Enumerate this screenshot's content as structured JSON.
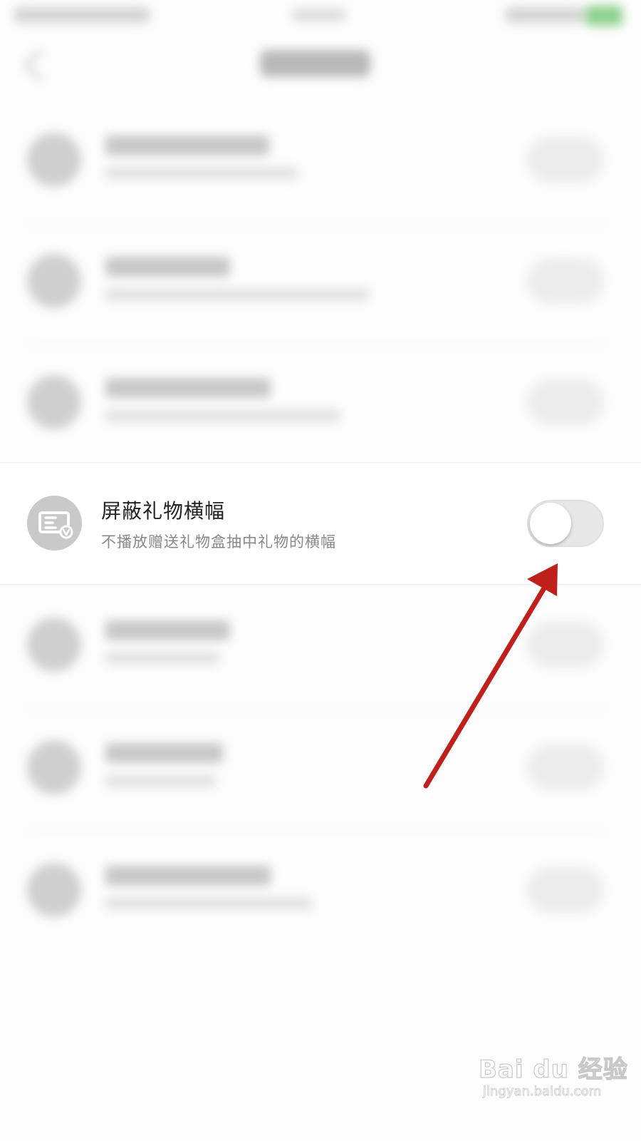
{
  "setting": {
    "title": "屏蔽礼物横幅",
    "description": "不播放赠送礼物盒抽中礼物的横幅",
    "icon": "banner-icon",
    "toggle_on": false
  },
  "annotation": {
    "arrow_color": "#c0201b"
  },
  "watermark": {
    "brand": "Bai du 经验",
    "url": "jingyan.baidu.com"
  },
  "colors": {
    "icon_bg": "#c9c9c9",
    "toggle_off_track": "#e7e7e7",
    "title_text": "#222222",
    "subtitle_text": "#888888"
  }
}
